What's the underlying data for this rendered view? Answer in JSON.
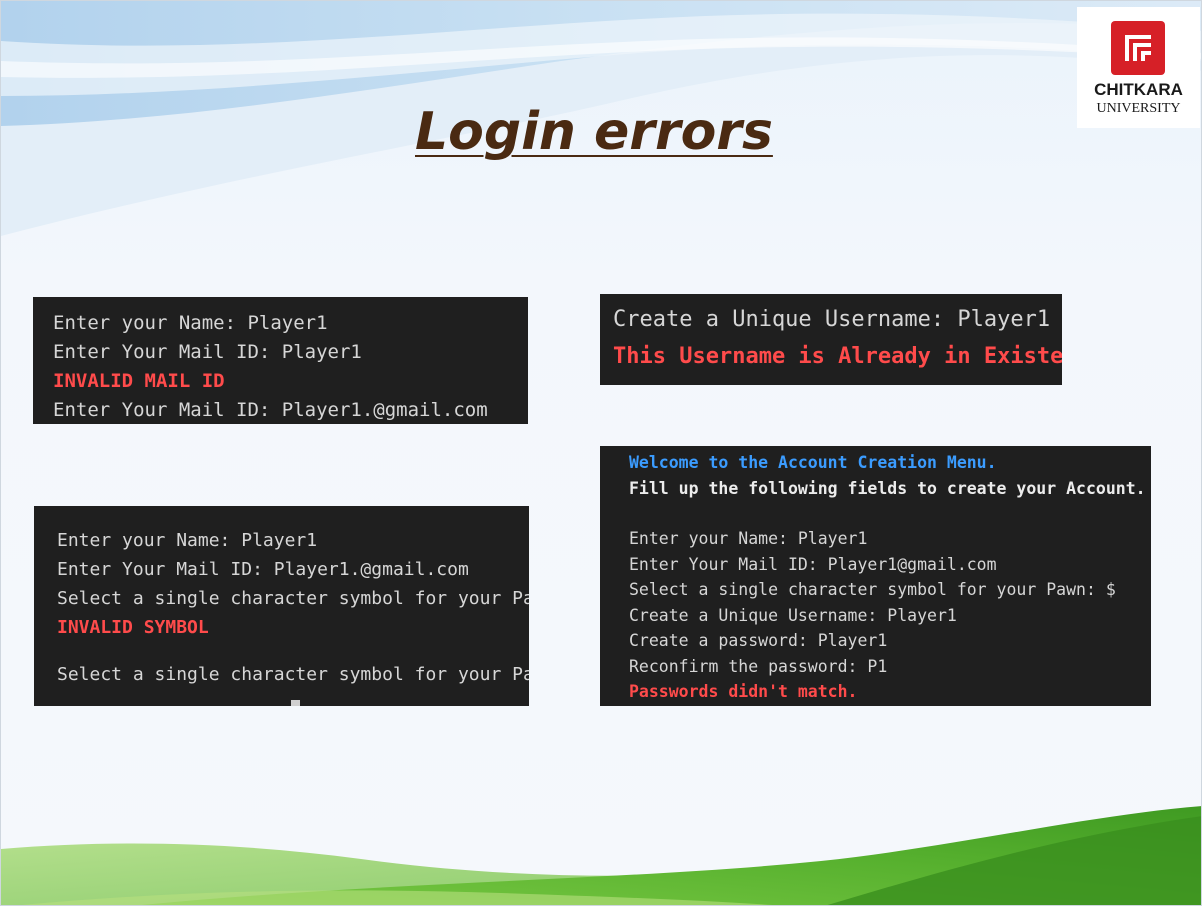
{
  "slide": {
    "title": "Login errors",
    "logo": {
      "name": "CHITKARA",
      "subtitle": "UNIVERSITY"
    }
  },
  "terminals": {
    "mail_error": {
      "lines": [
        "Enter your Name: Player1",
        "Enter Your Mail ID: Player1",
        "INVALID MAIL ID",
        "Enter Your Mail ID: Player1.@gmail.com"
      ]
    },
    "username_error": {
      "lines": [
        "Create a Unique Username: Player1",
        "This Username is Already in Existence."
      ]
    },
    "symbol_error": {
      "lines": [
        "Enter your Name: Player1",
        "Enter Your Mail ID: Player1.@gmail.com",
        "Select a single character symbol for your Pawn: :)",
        "INVALID SYMBOL",
        "Select a single character symbol for your Pawn: $"
      ]
    },
    "password_error": {
      "lines": [
        "Welcome to the Account Creation Menu.",
        "Fill up the following fields to create your Account.",
        "Enter your Name: Player1",
        "Enter Your Mail ID: Player1@gmail.com",
        "Select a single character symbol for your Pawn: $",
        "Create a Unique Username: Player1",
        "Create a password: Player1",
        "Reconfirm the password: P1",
        "Passwords didn't match."
      ]
    }
  },
  "colors": {
    "title": "#4a2a12",
    "terminal_bg": "#1f1f1f",
    "terminal_text": "#d6d6d6",
    "error": "#ff4b4b",
    "info": "#3b9cff",
    "brand_red": "#d62027"
  }
}
